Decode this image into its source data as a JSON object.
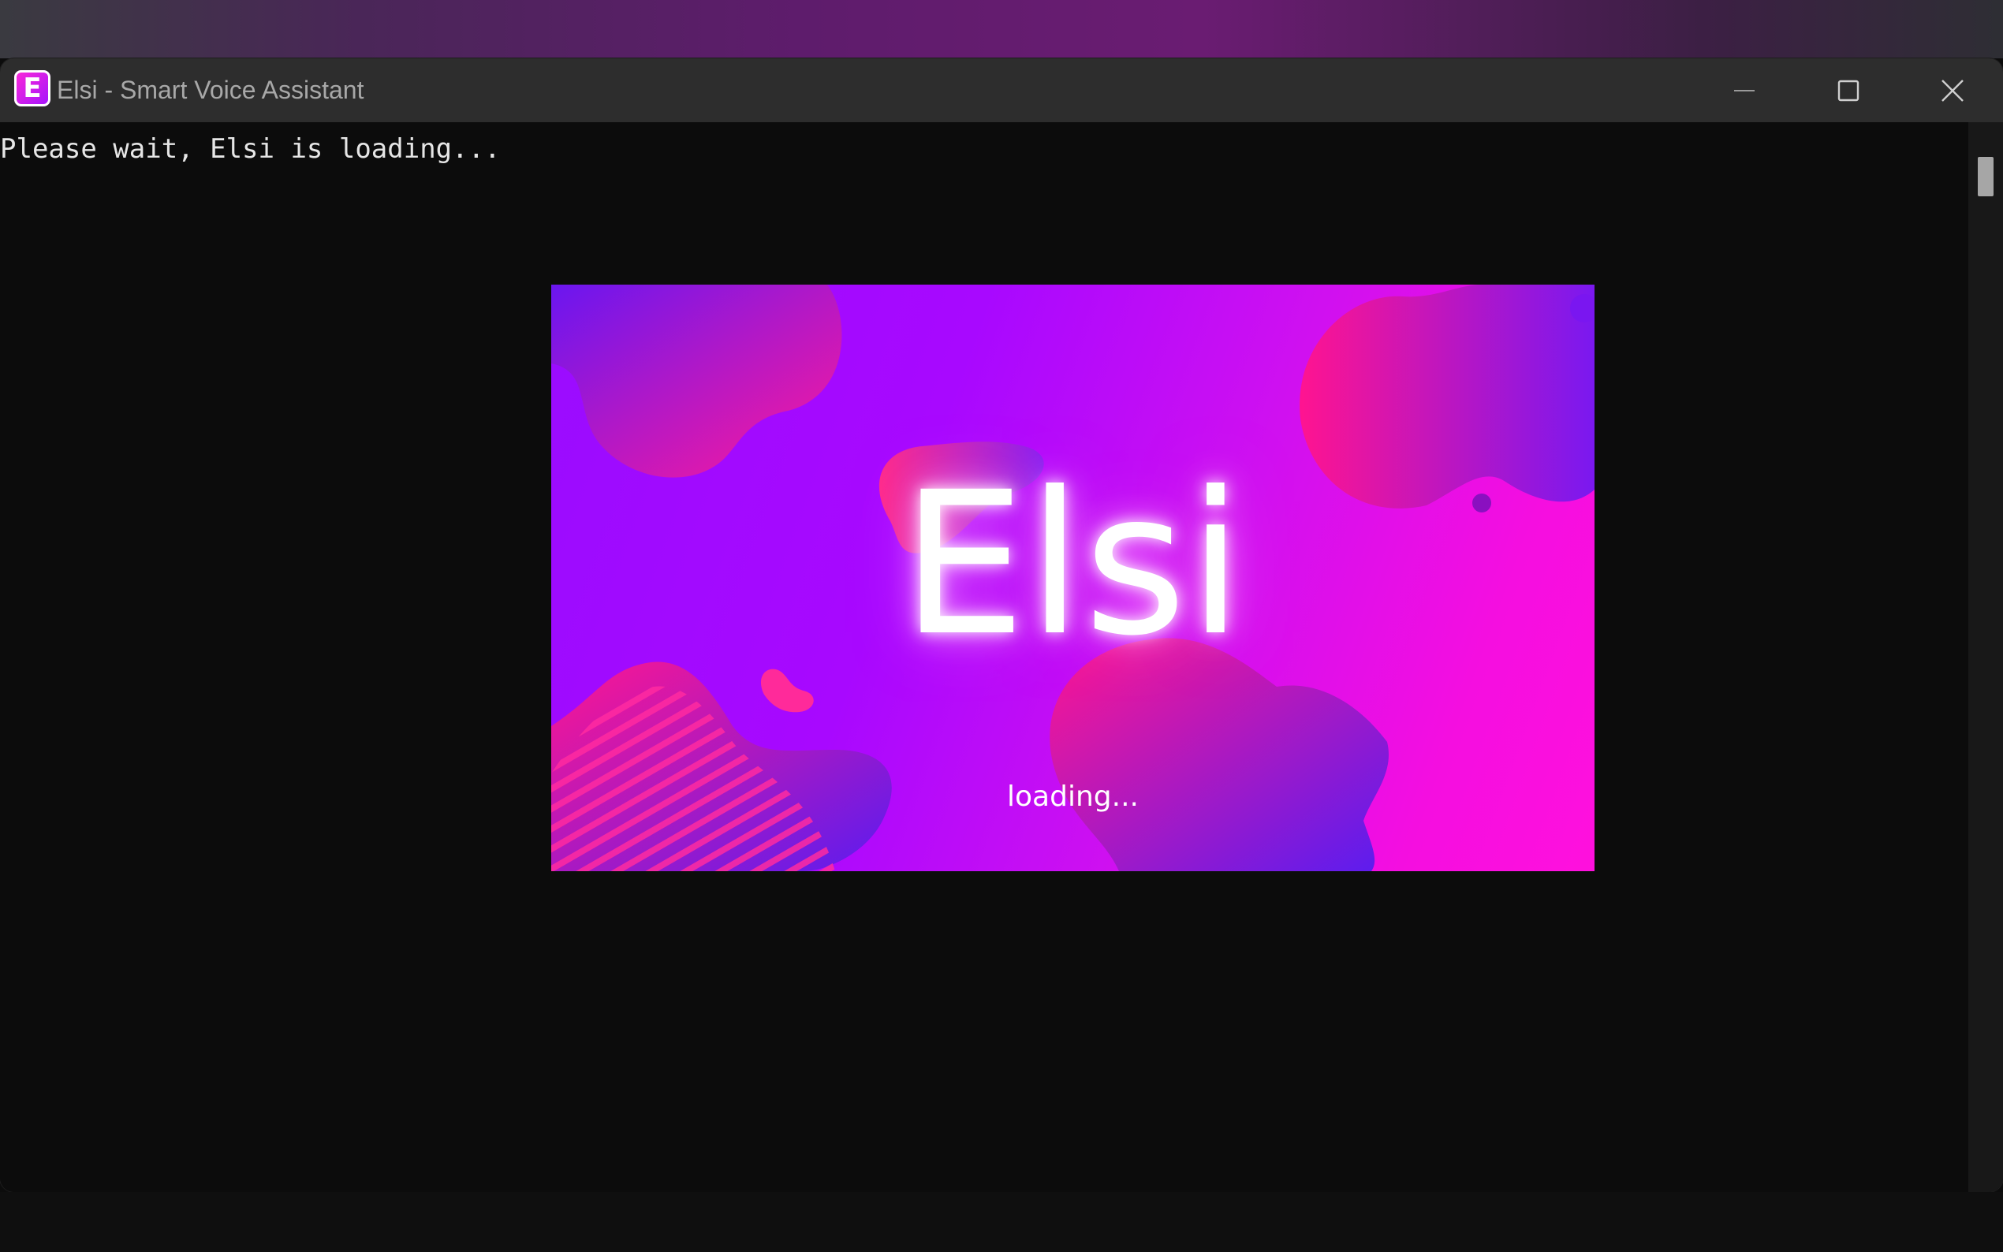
{
  "window": {
    "title": "Elsi - Smart Voice Assistant",
    "app_icon_letter": "E",
    "controls": {
      "minimize_icon": "minimize-icon",
      "maximize_icon": "maximize-icon",
      "close_icon": "close-icon"
    }
  },
  "console": {
    "line_1": "Please wait, Elsi is loading..."
  },
  "splash": {
    "logo_text": "Elsi",
    "status_text": "loading..."
  },
  "colors": {
    "titlebar": "#2d2d2d",
    "console_bg": "#0c0c0c",
    "splash_purple": "#a808ff",
    "splash_magenta": "#ff10dd"
  }
}
